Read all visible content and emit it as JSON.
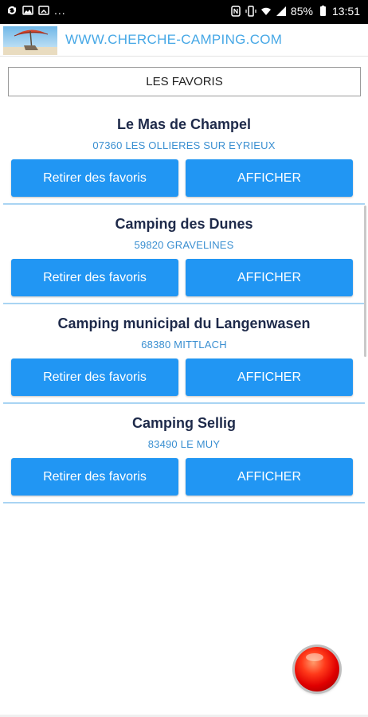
{
  "status_bar": {
    "overflow": "...",
    "battery_percent": "85%",
    "time": "13:51"
  },
  "header": {
    "site_title": "WWW.CHERCHE-CAMPING.COM",
    "logo": "beach-umbrella-logo"
  },
  "favorites_title": "LES FAVORIS",
  "entries": [
    {
      "name": "Le Mas de Champel",
      "address": "07360 LES OLLIERES SUR EYRIEUX",
      "remove_label": "Retirer des favoris",
      "show_label": "AFFICHER"
    },
    {
      "name": "Camping des Dunes",
      "address": "59820 GRAVELINES",
      "remove_label": "Retirer des favoris",
      "show_label": "AFFICHER"
    },
    {
      "name": "Camping municipal du Langenwasen",
      "address": "68380 MITTLACH",
      "remove_label": "Retirer des favoris",
      "show_label": "AFFICHER"
    },
    {
      "name": "Camping Sellig",
      "address": "83490 LE MUY",
      "remove_label": "Retirer des favoris",
      "show_label": "AFFICHER"
    }
  ],
  "colors": {
    "button": "#2196f3",
    "title_link": "#47a8e6",
    "address": "#3a8fd1",
    "name": "#1e2a4a",
    "divider": "#a9d4f3",
    "fab": "#e00000"
  }
}
